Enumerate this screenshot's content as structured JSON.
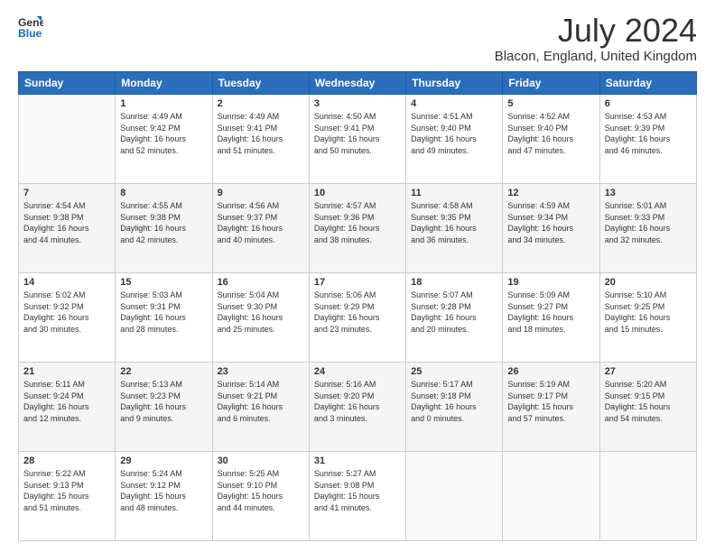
{
  "header": {
    "logo_line1": "General",
    "logo_line2": "Blue",
    "month_title": "July 2024",
    "location": "Blacon, England, United Kingdom"
  },
  "calendar": {
    "days_of_week": [
      "Sunday",
      "Monday",
      "Tuesday",
      "Wednesday",
      "Thursday",
      "Friday",
      "Saturday"
    ],
    "weeks": [
      [
        {
          "day": "",
          "info": ""
        },
        {
          "day": "1",
          "info": "Sunrise: 4:49 AM\nSunset: 9:42 PM\nDaylight: 16 hours\nand 52 minutes."
        },
        {
          "day": "2",
          "info": "Sunrise: 4:49 AM\nSunset: 9:41 PM\nDaylight: 16 hours\nand 51 minutes."
        },
        {
          "day": "3",
          "info": "Sunrise: 4:50 AM\nSunset: 9:41 PM\nDaylight: 16 hours\nand 50 minutes."
        },
        {
          "day": "4",
          "info": "Sunrise: 4:51 AM\nSunset: 9:40 PM\nDaylight: 16 hours\nand 49 minutes."
        },
        {
          "day": "5",
          "info": "Sunrise: 4:52 AM\nSunset: 9:40 PM\nDaylight: 16 hours\nand 47 minutes."
        },
        {
          "day": "6",
          "info": "Sunrise: 4:53 AM\nSunset: 9:39 PM\nDaylight: 16 hours\nand 46 minutes."
        }
      ],
      [
        {
          "day": "7",
          "info": "Sunrise: 4:54 AM\nSunset: 9:38 PM\nDaylight: 16 hours\nand 44 minutes."
        },
        {
          "day": "8",
          "info": "Sunrise: 4:55 AM\nSunset: 9:38 PM\nDaylight: 16 hours\nand 42 minutes."
        },
        {
          "day": "9",
          "info": "Sunrise: 4:56 AM\nSunset: 9:37 PM\nDaylight: 16 hours\nand 40 minutes."
        },
        {
          "day": "10",
          "info": "Sunrise: 4:57 AM\nSunset: 9:36 PM\nDaylight: 16 hours\nand 38 minutes."
        },
        {
          "day": "11",
          "info": "Sunrise: 4:58 AM\nSunset: 9:35 PM\nDaylight: 16 hours\nand 36 minutes."
        },
        {
          "day": "12",
          "info": "Sunrise: 4:59 AM\nSunset: 9:34 PM\nDaylight: 16 hours\nand 34 minutes."
        },
        {
          "day": "13",
          "info": "Sunrise: 5:01 AM\nSunset: 9:33 PM\nDaylight: 16 hours\nand 32 minutes."
        }
      ],
      [
        {
          "day": "14",
          "info": "Sunrise: 5:02 AM\nSunset: 9:32 PM\nDaylight: 16 hours\nand 30 minutes."
        },
        {
          "day": "15",
          "info": "Sunrise: 5:03 AM\nSunset: 9:31 PM\nDaylight: 16 hours\nand 28 minutes."
        },
        {
          "day": "16",
          "info": "Sunrise: 5:04 AM\nSunset: 9:30 PM\nDaylight: 16 hours\nand 25 minutes."
        },
        {
          "day": "17",
          "info": "Sunrise: 5:06 AM\nSunset: 9:29 PM\nDaylight: 16 hours\nand 23 minutes."
        },
        {
          "day": "18",
          "info": "Sunrise: 5:07 AM\nSunset: 9:28 PM\nDaylight: 16 hours\nand 20 minutes."
        },
        {
          "day": "19",
          "info": "Sunrise: 5:09 AM\nSunset: 9:27 PM\nDaylight: 16 hours\nand 18 minutes."
        },
        {
          "day": "20",
          "info": "Sunrise: 5:10 AM\nSunset: 9:25 PM\nDaylight: 16 hours\nand 15 minutes."
        }
      ],
      [
        {
          "day": "21",
          "info": "Sunrise: 5:11 AM\nSunset: 9:24 PM\nDaylight: 16 hours\nand 12 minutes."
        },
        {
          "day": "22",
          "info": "Sunrise: 5:13 AM\nSunset: 9:23 PM\nDaylight: 16 hours\nand 9 minutes."
        },
        {
          "day": "23",
          "info": "Sunrise: 5:14 AM\nSunset: 9:21 PM\nDaylight: 16 hours\nand 6 minutes."
        },
        {
          "day": "24",
          "info": "Sunrise: 5:16 AM\nSunset: 9:20 PM\nDaylight: 16 hours\nand 3 minutes."
        },
        {
          "day": "25",
          "info": "Sunrise: 5:17 AM\nSunset: 9:18 PM\nDaylight: 16 hours\nand 0 minutes."
        },
        {
          "day": "26",
          "info": "Sunrise: 5:19 AM\nSunset: 9:17 PM\nDaylight: 15 hours\nand 57 minutes."
        },
        {
          "day": "27",
          "info": "Sunrise: 5:20 AM\nSunset: 9:15 PM\nDaylight: 15 hours\nand 54 minutes."
        }
      ],
      [
        {
          "day": "28",
          "info": "Sunrise: 5:22 AM\nSunset: 9:13 PM\nDaylight: 15 hours\nand 51 minutes."
        },
        {
          "day": "29",
          "info": "Sunrise: 5:24 AM\nSunset: 9:12 PM\nDaylight: 15 hours\nand 48 minutes."
        },
        {
          "day": "30",
          "info": "Sunrise: 5:25 AM\nSunset: 9:10 PM\nDaylight: 15 hours\nand 44 minutes."
        },
        {
          "day": "31",
          "info": "Sunrise: 5:27 AM\nSunset: 9:08 PM\nDaylight: 15 hours\nand 41 minutes."
        },
        {
          "day": "",
          "info": ""
        },
        {
          "day": "",
          "info": ""
        },
        {
          "day": "",
          "info": ""
        }
      ]
    ]
  }
}
